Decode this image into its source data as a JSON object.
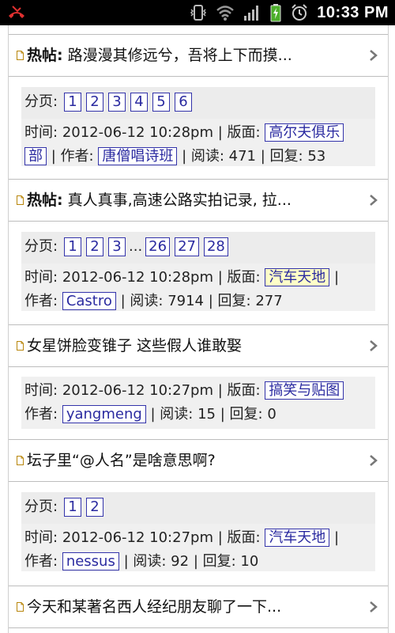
{
  "status": {
    "time": "10:33 PM"
  },
  "threads": [
    {
      "prefix": "热帖:",
      "title": "路漫漫其修远兮，吾将上下而摸..."
    },
    {
      "prefix": "热帖:",
      "title": "真人真事,高速公路实拍记录, 拉..."
    },
    {
      "prefix": "",
      "title": "女星饼脸变锥子 这些假人谁敢娶"
    },
    {
      "prefix": "",
      "title": "坛子里“@人名”是啥意思啊?"
    },
    {
      "prefix": "",
      "title": "今天和某著名西人经纪朋友聊了一下..."
    }
  ],
  "panels": [
    {
      "page_label": "分页:",
      "pages": [
        "1",
        "2",
        "3",
        "4",
        "5",
        "6"
      ],
      "ellipsis": "",
      "pages_tail": [],
      "time_label": "时间:",
      "time": "2012-06-12 10:28pm",
      "board_label": "| 版面:",
      "board": "高尔夫俱乐部",
      "board_line1": "高尔夫俱乐",
      "board_line2": "部",
      "author_label": "| 作者:",
      "author": "唐僧唱诗班",
      "reads_label": "| 阅读:",
      "reads": "471",
      "replies_label": "| 回复:",
      "replies": "53"
    },
    {
      "page_label": "分页:",
      "pages": [
        "1",
        "2",
        "3"
      ],
      "ellipsis": "...",
      "pages_tail": [
        "26",
        "27",
        "28"
      ],
      "time_label": "时间:",
      "time": "2012-06-12 10:28pm",
      "board_label": "| 版面:",
      "board": "汽车天地",
      "author_label": "作者:",
      "author": "Castro",
      "reads_label": "| 阅读:",
      "reads": "7914",
      "replies_label": "| 回复:",
      "replies": "277"
    },
    {
      "time_label": "时间:",
      "time": "2012-06-12 10:27pm",
      "board_label": "| 版面:",
      "board": "搞笑与贴图",
      "author_label": "作者:",
      "author": "yangmeng",
      "reads_label": "| 阅读:",
      "reads": "15",
      "replies_label": "| 回复:",
      "replies": "0"
    },
    {
      "page_label": "分页:",
      "pages": [
        "1",
        "2"
      ],
      "ellipsis": "",
      "pages_tail": [],
      "time_label": "时间:",
      "time": "2012-06-12 10:27pm",
      "board_label": "| 版面:",
      "board": "汽车天地",
      "author_label": "作者:",
      "author": "nessus",
      "reads_label": "| 阅读:",
      "reads": "92",
      "replies_label": "| 回复:",
      "replies": "10"
    }
  ],
  "pipe": "|",
  "colors": {
    "link": "#2a2aa0",
    "highlight": "#ffffc8",
    "panel_bg": "#f0f0f0"
  }
}
